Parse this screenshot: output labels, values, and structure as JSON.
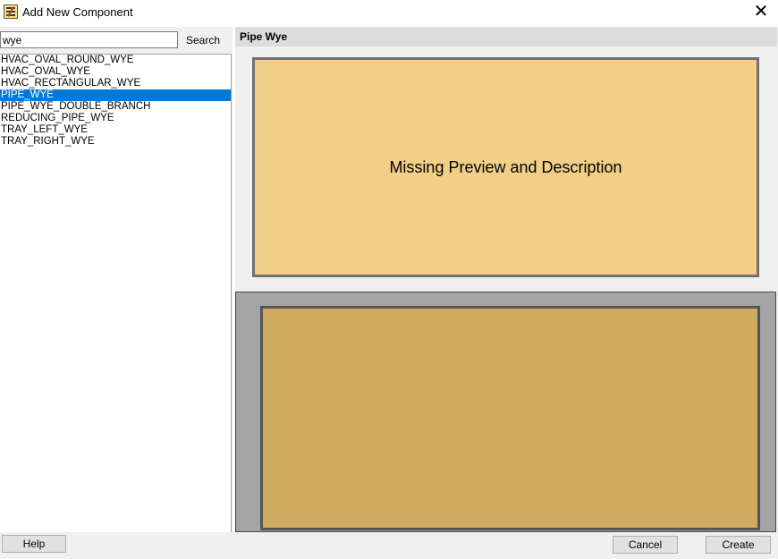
{
  "window": {
    "title": "Add New Component",
    "close_glyph": "✕",
    "app_icon": "component-app-icon"
  },
  "search": {
    "value": "wye",
    "button_label": "Search"
  },
  "components": {
    "items": [
      {
        "label": "HVAC_OVAL_ROUND_WYE",
        "selected": false
      },
      {
        "label": "HVAC_OVAL_WYE",
        "selected": false
      },
      {
        "label": "HVAC_RECTANGULAR_WYE",
        "selected": false
      },
      {
        "label": "PIPE_WYE",
        "selected": true
      },
      {
        "label": "PIPE_WYE_DOUBLE_BRANCH",
        "selected": false
      },
      {
        "label": "REDUCING_PIPE_WYE",
        "selected": false
      },
      {
        "label": "TRAY_LEFT_WYE",
        "selected": false
      },
      {
        "label": "TRAY_RIGHT_WYE",
        "selected": false
      }
    ]
  },
  "preview": {
    "title": "Pipe Wye",
    "missing_text": "Missing Preview and Description"
  },
  "footer": {
    "help_label": "Help",
    "cancel_label": "Cancel",
    "create_label": "Create"
  },
  "colors": {
    "selection": "#0078d7",
    "preview_fill": "#f2cf86",
    "description_fill": "#cfab5f"
  }
}
